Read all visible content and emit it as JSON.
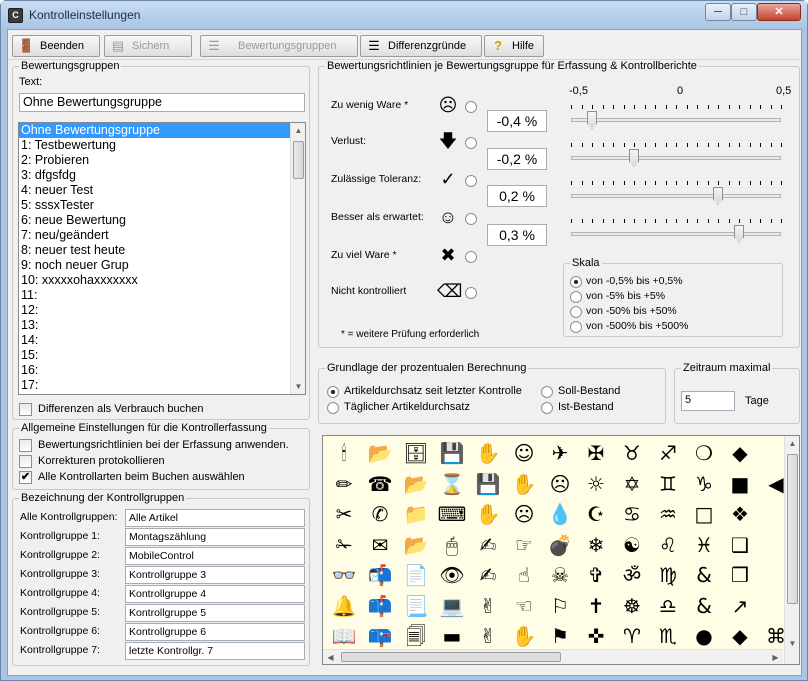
{
  "window": {
    "title": "Kontrolleinstellungen",
    "app_icon": "app-icon",
    "minimize": "─",
    "maximize": "□",
    "close": "✕"
  },
  "toolbar": {
    "beenden": "Beenden",
    "sichern": "Sichern",
    "bewertungsgruppen": "Bewertungsgruppen",
    "differenzgruende": "Differenzgründe",
    "hilfe": "Hilfe"
  },
  "bewertungsgruppen": {
    "legend": "Bewertungsgruppen",
    "text_label": "Text:",
    "text_value": "Ohne Bewertungsgruppe",
    "items": [
      "Ohne Bewertungsgruppe",
      "1: Testbewertung",
      "2: Probieren",
      "3: dfgsfdg",
      "4: neuer Test",
      "5: sssxTester",
      "6: neue Bewertung",
      "7: neu/geändert",
      "8: neuer test heute",
      "9: noch neuer Grup",
      "10: xxxxxohaxxxxxxx",
      "11:",
      "12:",
      "13:",
      "14:",
      "15:",
      "16:",
      "17:"
    ],
    "differenzen_label": "Differenzen als Verbrauch buchen"
  },
  "allgemein": {
    "legend": "Allgemeine Einstellungen für die Kontrollerfassung",
    "opt1": "Bewertungsrichtlinien bei der Erfassung anwenden.",
    "opt2": "Korrekturen protokollieren",
    "opt3": "Alle Kontrollarten beim Buchen auswählen",
    "check": "✔"
  },
  "kontrollgruppen": {
    "legend": "Bezeichnung der Kontrollgruppen",
    "rows": [
      {
        "label": "Alle Kontrollgruppen:",
        "value": "Alle Artikel"
      },
      {
        "label": "Kontrollgruppe 1:",
        "value": "Montagszählung"
      },
      {
        "label": "Kontrollgruppe 2:",
        "value": "MobileControl"
      },
      {
        "label": "Kontrollgruppe 3:",
        "value": "Kontrollgruppe 3"
      },
      {
        "label": "Kontrollgruppe 4:",
        "value": "Kontrollgruppe 4"
      },
      {
        "label": "Kontrollgruppe 5:",
        "value": "Kontrollgruppe 5"
      },
      {
        "label": "Kontrollgruppe 6:",
        "value": "Kontrollgruppe 6"
      },
      {
        "label": "Kontrollgruppe 7:",
        "value": "letzte Kontrollgr. 7"
      }
    ]
  },
  "richtlinien": {
    "legend": "Bewertungsrichtlinien je Bewertungsgruppe für Erfassung & Kontrollberichte",
    "rows": [
      {
        "label": "Zu wenig Ware *",
        "symbol": "☹",
        "icon": "frown-icon"
      },
      {
        "label": "Verlust:",
        "symbol": "🡇",
        "icon": "down-arrow-icon"
      },
      {
        "label": "Zulässige Toleranz:",
        "symbol": "✓",
        "icon": "checkmark-icon"
      },
      {
        "label": "Besser als erwartet:",
        "symbol": "☺",
        "icon": "smile-icon"
      },
      {
        "label": "Zu viel Ware *",
        "symbol": "✖",
        "icon": "cross-icon"
      },
      {
        "label": "Nicht kontrolliert",
        "symbol": "⌫",
        "icon": "erase-icon"
      }
    ],
    "percents": [
      "-0,4 %",
      "-0,2 %",
      "0,2 %",
      "0,3 %"
    ],
    "slider_values": [
      -0.4,
      -0.2,
      0.2,
      0.3
    ],
    "scale_min": "-0,5",
    "scale_mid": "0",
    "scale_max": "0,5",
    "footnote": "* = weitere Prüfung erforderlich",
    "skala": {
      "legend": "Skala",
      "options": [
        "von -0,5% bis +0,5%",
        "von -5% bis +5%",
        "von -50% bis +50%",
        "von -500% bis +500%"
      ],
      "selected": 0
    }
  },
  "grundlage": {
    "legend": "Grundlage der prozentualen Berechnung",
    "opt1": "Artikeldurchsatz seit letzter Kontrolle",
    "opt2": "Täglicher Artikeldurchsatz",
    "opt3": "Soll-Bestand",
    "opt4": "Ist-Bestand"
  },
  "zeitraum": {
    "legend": "Zeitraum maximal",
    "value": "5",
    "unit": "Tage"
  },
  "icon_grid": [
    [
      "🕯",
      "📂",
      "🗄",
      "💾",
      "✋",
      "☺",
      "✈",
      "✠",
      "♉",
      "♐",
      "❍",
      "◆"
    ],
    [
      "✏",
      "☎",
      "📂",
      "⌛",
      "💾",
      "✋",
      "☹",
      "☼",
      "✡",
      "♊",
      "♑",
      "■",
      "◀"
    ],
    [
      "✂",
      "✆",
      "📁",
      "⌨",
      "✋",
      "☹",
      "💧",
      "☪",
      "♋",
      "♒",
      "□",
      "❖"
    ],
    [
      "✁",
      "✉",
      "📂",
      "🖱",
      "✍",
      "☞",
      "💣",
      "❄",
      "☯",
      "♌",
      "♓",
      "❑"
    ],
    [
      "👓",
      "📬",
      "📄",
      "👁",
      "✍",
      "☝",
      "☠",
      "✞",
      "ॐ",
      "♍",
      "&",
      "❒"
    ],
    [
      "🔔",
      "📫",
      "📃",
      "💻",
      "✌",
      "☜",
      "⚐",
      "✝",
      "☸",
      "♎",
      "&",
      "↗"
    ],
    [
      "📖",
      "📪",
      "🗐",
      "▬",
      "✌",
      "✋",
      "⚑",
      "✜",
      "♈",
      "♏",
      "●",
      "◆",
      "⌘"
    ]
  ]
}
